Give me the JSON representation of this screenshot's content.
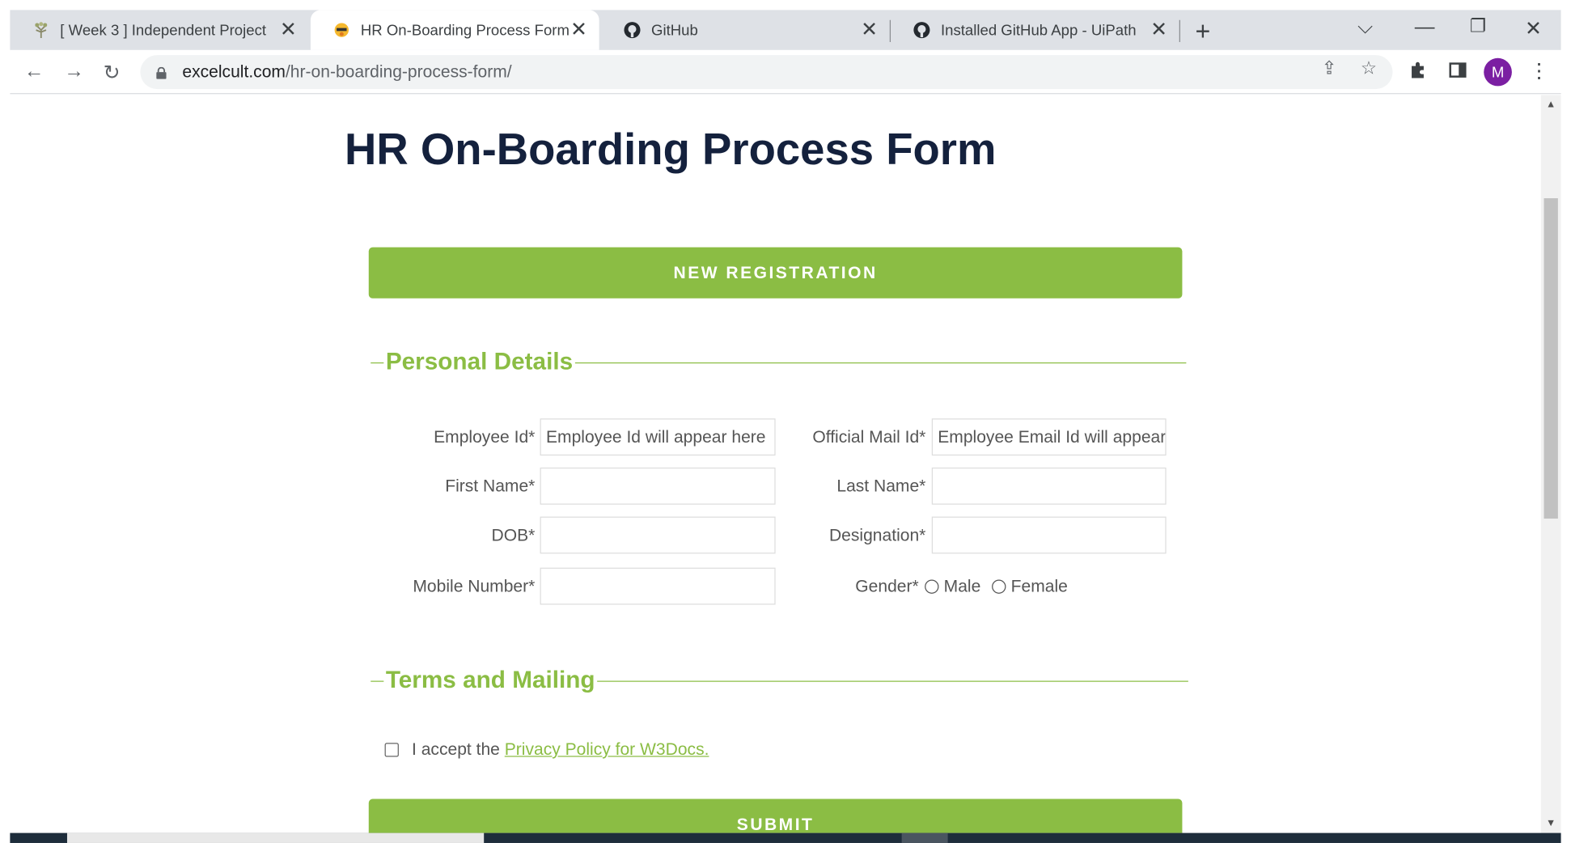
{
  "browser": {
    "tabs": [
      {
        "title": "[ Week 3 ] Independent Project",
        "icon": "tree-icon"
      },
      {
        "title": "HR On-Boarding Process Form –",
        "icon": "excelcult-icon",
        "active": true
      },
      {
        "title": "GitHub",
        "icon": "github-icon"
      },
      {
        "title": "Installed GitHub App - UiPath",
        "icon": "github-icon"
      }
    ],
    "url_domain": "excelcult.com",
    "url_path": "/hr-on-boarding-process-form/",
    "profile_initial": "M",
    "profile_color": "#7b1fa2"
  },
  "page": {
    "title": "HR On-Boarding Process Form",
    "new_registration": "NEW REGISTRATION",
    "personal_details": "Personal Details",
    "fields": {
      "employee_id_label": "Employee Id*",
      "employee_id_placeholder": "Employee Id will appear here",
      "official_mail_label": "Official Mail Id*",
      "official_mail_placeholder": "Employee Email Id will appear",
      "first_name_label": "First Name*",
      "last_name_label": "Last Name*",
      "dob_label": "DOB*",
      "designation_label": "Designation*",
      "mobile_label": "Mobile Number*",
      "gender_label": "Gender*",
      "gender_male": "Male",
      "gender_female": "Female"
    },
    "terms_and_mailing": "Terms and Mailing",
    "accept_text": "I accept the",
    "privacy_link": "Privacy Policy for W3Docs.",
    "submit": "SUBMIT",
    "accent_color": "#8bbd44",
    "title_color": "#14213d"
  }
}
